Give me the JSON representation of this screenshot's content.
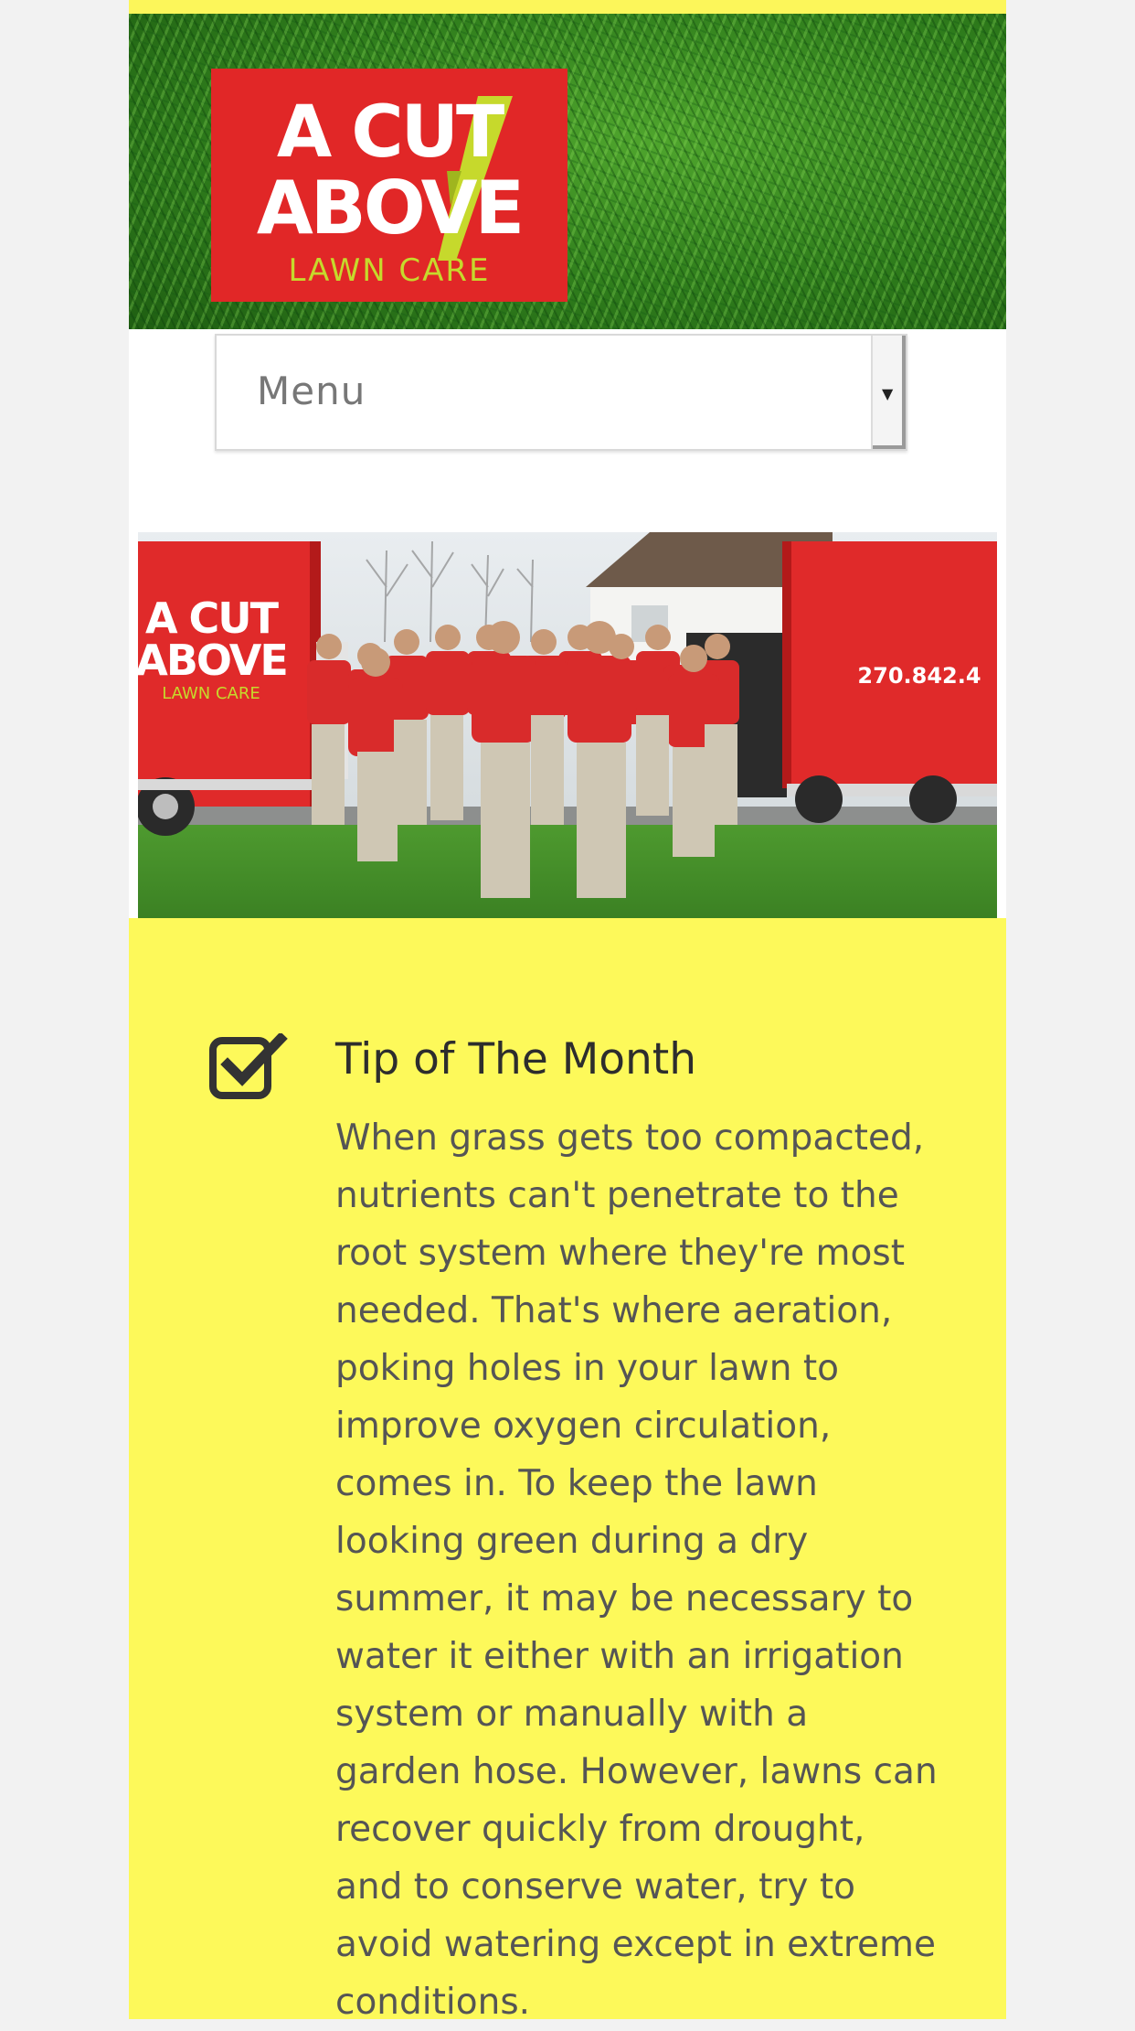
{
  "logo": {
    "line1": "A CUT",
    "line2": "ABOVE",
    "line3": "LAWN CARE"
  },
  "menu": {
    "label": "Menu"
  },
  "photo": {
    "truck_logo_line1": "A CUT",
    "truck_logo_line2": "ABOVE",
    "truck_logo_line3": "LAWN CARE",
    "truck_phone": "270.842.4"
  },
  "tip": {
    "title": "Tip of The Month",
    "body": "When grass gets too compacted, nutrients can't penetrate to the root system where they're most needed. That's where aeration, poking holes in your lawn to improve oxygen circulation, comes in. To keep the lawn looking green during a dry summer, it may be necessary to water it either with an irrigation system or manually with a garden hose. However, lawns can recover quickly from drought, and to conserve water, try to avoid watering except in extreme conditions."
  },
  "colors": {
    "brand_red": "#e12727",
    "brand_yellow": "#fdf95a",
    "logo_green": "#c6d92c",
    "grass_green": "#2f7d1c"
  }
}
